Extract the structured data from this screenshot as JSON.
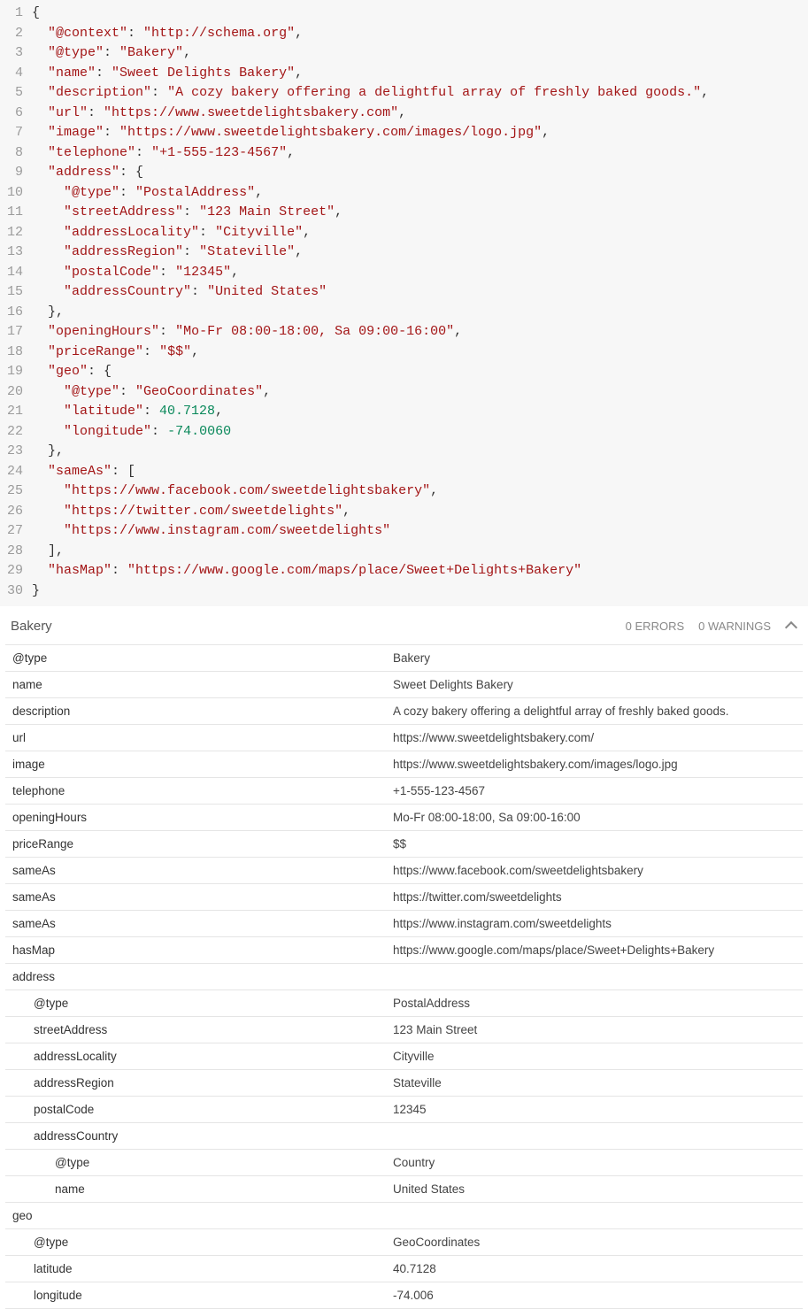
{
  "code": {
    "lines": [
      {
        "n": "1",
        "html": "<span class='p'>{</span>"
      },
      {
        "n": "2",
        "html": "  <span class='str'>\"@context\"</span><span class='p'>: </span><span class='str'>\"http://schema.org\"</span><span class='p'>,</span>"
      },
      {
        "n": "3",
        "html": "  <span class='str'>\"@type\"</span><span class='p'>: </span><span class='str'>\"Bakery\"</span><span class='p'>,</span>"
      },
      {
        "n": "4",
        "html": "  <span class='str'>\"name\"</span><span class='p'>: </span><span class='str'>\"Sweet Delights Bakery\"</span><span class='p'>,</span>"
      },
      {
        "n": "5",
        "html": "  <span class='str'>\"description\"</span><span class='p'>: </span><span class='str'>\"A cozy bakery offering a delightful array of freshly baked goods.\"</span><span class='p'>,</span>"
      },
      {
        "n": "6",
        "html": "  <span class='str'>\"url\"</span><span class='p'>: </span><span class='str'>\"https://www.sweetdelightsbakery.com\"</span><span class='p'>,</span>"
      },
      {
        "n": "7",
        "html": "  <span class='str'>\"image\"</span><span class='p'>: </span><span class='str'>\"https://www.sweetdelightsbakery.com/images/logo.jpg\"</span><span class='p'>,</span>"
      },
      {
        "n": "8",
        "html": "  <span class='str'>\"telephone\"</span><span class='p'>: </span><span class='str'>\"+1-555-123-4567\"</span><span class='p'>,</span>"
      },
      {
        "n": "9",
        "html": "  <span class='str'>\"address\"</span><span class='p'>: {</span>"
      },
      {
        "n": "10",
        "html": "    <span class='str'>\"@type\"</span><span class='p'>: </span><span class='str'>\"PostalAddress\"</span><span class='p'>,</span>"
      },
      {
        "n": "11",
        "html": "    <span class='str'>\"streetAddress\"</span><span class='p'>: </span><span class='str'>\"123 Main Street\"</span><span class='p'>,</span>"
      },
      {
        "n": "12",
        "html": "    <span class='str'>\"addressLocality\"</span><span class='p'>: </span><span class='str'>\"Cityville\"</span><span class='p'>,</span>"
      },
      {
        "n": "13",
        "html": "    <span class='str'>\"addressRegion\"</span><span class='p'>: </span><span class='str'>\"Stateville\"</span><span class='p'>,</span>"
      },
      {
        "n": "14",
        "html": "    <span class='str'>\"postalCode\"</span><span class='p'>: </span><span class='str'>\"12345\"</span><span class='p'>,</span>"
      },
      {
        "n": "15",
        "html": "    <span class='str'>\"addressCountry\"</span><span class='p'>: </span><span class='str'>\"United States\"</span>"
      },
      {
        "n": "16",
        "html": "  <span class='p'>},</span>"
      },
      {
        "n": "17",
        "html": "  <span class='str'>\"openingHours\"</span><span class='p'>: </span><span class='str'>\"Mo-Fr 08:00-18:00, Sa 09:00-16:00\"</span><span class='p'>,</span>"
      },
      {
        "n": "18",
        "html": "  <span class='str'>\"priceRange\"</span><span class='p'>: </span><span class='str'>\"$$\"</span><span class='p'>,</span>"
      },
      {
        "n": "19",
        "html": "  <span class='str'>\"geo\"</span><span class='p'>: {</span>"
      },
      {
        "n": "20",
        "html": "    <span class='str'>\"@type\"</span><span class='p'>: </span><span class='str'>\"GeoCoordinates\"</span><span class='p'>,</span>"
      },
      {
        "n": "21",
        "html": "    <span class='str'>\"latitude\"</span><span class='p'>: </span><span class='num'>40.7128</span><span class='p'>,</span>"
      },
      {
        "n": "22",
        "html": "    <span class='str'>\"longitude\"</span><span class='p'>: </span><span class='num'>-74.0060</span>"
      },
      {
        "n": "23",
        "html": "  <span class='p'>},</span>"
      },
      {
        "n": "24",
        "html": "  <span class='str'>\"sameAs\"</span><span class='p'>: [</span>"
      },
      {
        "n": "25",
        "html": "    <span class='str'>\"https://www.facebook.com/sweetdelightsbakery\"</span><span class='p'>,</span>"
      },
      {
        "n": "26",
        "html": "    <span class='str'>\"https://twitter.com/sweetdelights\"</span><span class='p'>,</span>"
      },
      {
        "n": "27",
        "html": "    <span class='str'>\"https://www.instagram.com/sweetdelights\"</span>"
      },
      {
        "n": "28",
        "html": "  <span class='p'>],</span>"
      },
      {
        "n": "29",
        "html": "  <span class='str'>\"hasMap\"</span><span class='p'>: </span><span class='str'>\"https://www.google.com/maps/place/Sweet+Delights+Bakery\"</span>"
      },
      {
        "n": "30",
        "html": "<span class='p'>}</span>"
      }
    ]
  },
  "summary": {
    "title": "Bakery",
    "errors_label": "0 ERRORS",
    "warnings_label": "0 WARNINGS"
  },
  "rows": [
    {
      "key": "@type",
      "val": "Bakery",
      "indent": 0
    },
    {
      "key": "name",
      "val": "Sweet Delights Bakery",
      "indent": 0
    },
    {
      "key": "description",
      "val": "A cozy bakery offering a delightful array of freshly baked goods.",
      "indent": 0
    },
    {
      "key": "url",
      "val": "https://www.sweetdelightsbakery.com/",
      "indent": 0
    },
    {
      "key": "image",
      "val": "https://www.sweetdelightsbakery.com/images/logo.jpg",
      "indent": 0
    },
    {
      "key": "telephone",
      "val": "+1-555-123-4567",
      "indent": 0
    },
    {
      "key": "openingHours",
      "val": "Mo-Fr 08:00-18:00, Sa 09:00-16:00",
      "indent": 0
    },
    {
      "key": "priceRange",
      "val": "$$",
      "indent": 0
    },
    {
      "key": "sameAs",
      "val": "https://www.facebook.com/sweetdelightsbakery",
      "indent": 0
    },
    {
      "key": "sameAs",
      "val": "https://twitter.com/sweetdelights",
      "indent": 0
    },
    {
      "key": "sameAs",
      "val": "https://www.instagram.com/sweetdelights",
      "indent": 0
    },
    {
      "key": "hasMap",
      "val": "https://www.google.com/maps/place/Sweet+Delights+Bakery",
      "indent": 0
    },
    {
      "key": "address",
      "val": "",
      "indent": 0
    },
    {
      "key": "@type",
      "val": "PostalAddress",
      "indent": 1
    },
    {
      "key": "streetAddress",
      "val": "123 Main Street",
      "indent": 1
    },
    {
      "key": "addressLocality",
      "val": "Cityville",
      "indent": 1
    },
    {
      "key": "addressRegion",
      "val": "Stateville",
      "indent": 1
    },
    {
      "key": "postalCode",
      "val": "12345",
      "indent": 1
    },
    {
      "key": "addressCountry",
      "val": "",
      "indent": 1
    },
    {
      "key": "@type",
      "val": "Country",
      "indent": 2
    },
    {
      "key": "name",
      "val": "United States",
      "indent": 2
    },
    {
      "key": "geo",
      "val": "",
      "indent": 0
    },
    {
      "key": "@type",
      "val": "GeoCoordinates",
      "indent": 1
    },
    {
      "key": "latitude",
      "val": "40.7128",
      "indent": 1
    },
    {
      "key": "longitude",
      "val": "-74.006",
      "indent": 1
    }
  ]
}
